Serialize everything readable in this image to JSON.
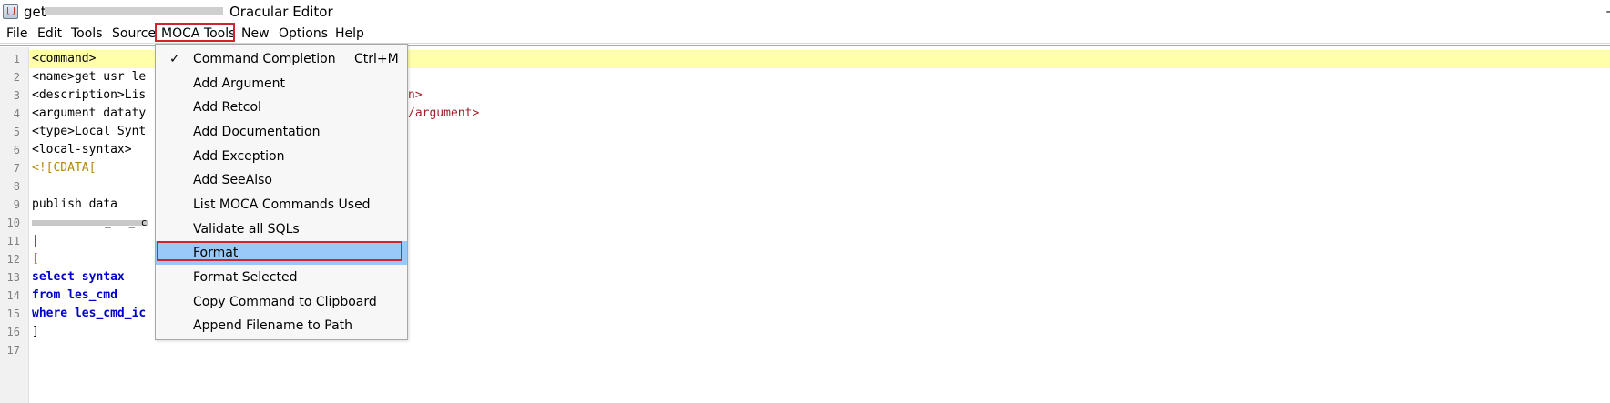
{
  "window": {
    "title_prefix": "get",
    "title": "Oracular Editor",
    "minimize_glyph": "–",
    "app_icon": "java-cup-icon"
  },
  "menubar": {
    "items": [
      "File",
      "Edit",
      "Tools",
      "Source",
      "MOCA Tools",
      "New",
      "Options",
      "Help"
    ],
    "active": "MOCA Tools"
  },
  "editor": {
    "line_numbers": [
      "1",
      "2",
      "3",
      "4",
      "5",
      "6",
      "7",
      "8",
      "9",
      "10",
      "11",
      "12",
      "13",
      "14",
      "15",
      "16",
      "17"
    ],
    "lines": [
      "<command>",
      "<name>get usr le",
      "<description>Lis",
      "<argument dataty",
      "<type>Local Synt",
      "<local-syntax>",
      "<![CDATA[",
      "",
      "publish data",
      "",
      "|",
      "[",
      "select syntax",
      "from les_cmd",
      "where les_cmd_ic",
      "]",
      ""
    ],
    "line3_suffix": "n>",
    "line4_suffix": "/argument>",
    "line10_tail": "_   _ c"
  },
  "dropdown": {
    "items": [
      {
        "label": "Command Completion",
        "shortcut": "Ctrl+M",
        "checked": true
      },
      {
        "label": "Add Argument"
      },
      {
        "label": "Add Retcol"
      },
      {
        "label": "Add Documentation"
      },
      {
        "label": "Add Exception"
      },
      {
        "label": "Add SeeAlso"
      },
      {
        "label": "List MOCA Commands Used"
      },
      {
        "label": "Validate all SQLs"
      },
      {
        "label": "Format",
        "selected": true
      },
      {
        "label": "Format Selected"
      },
      {
        "label": "Copy Command to Clipboard"
      },
      {
        "label": "Append Filename to Path"
      }
    ],
    "check_glyph": "✓"
  },
  "colors": {
    "highlight_box": "#d3232f",
    "selected_item": "#99c9f9",
    "current_line": "#ffffaa",
    "keyword": "#0000cc"
  }
}
